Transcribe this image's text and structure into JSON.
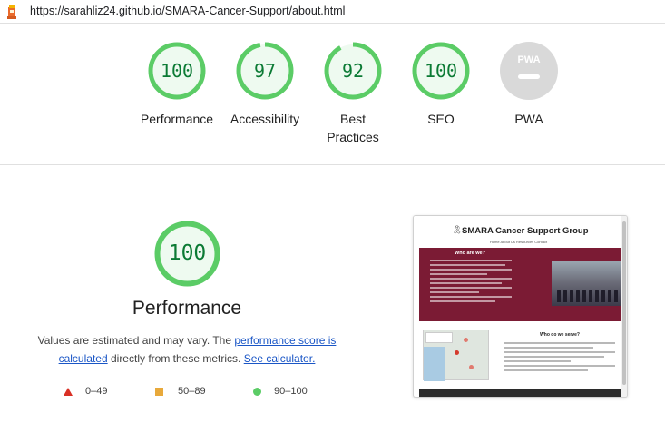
{
  "url": "https://sarahliz24.github.io/SMARA-Cancer-Support/about.html",
  "categories": [
    {
      "label": "Performance",
      "score": "100",
      "value": 100
    },
    {
      "label": "Accessibility",
      "score": "97",
      "value": 97
    },
    {
      "label_line1": "Best",
      "label_line2": "Practices",
      "score": "92",
      "value": 92
    },
    {
      "label": "SEO",
      "score": "100",
      "value": 100
    },
    {
      "label": "PWA",
      "badge": "PWA"
    }
  ],
  "section": {
    "score": "100",
    "value": 100,
    "title": "Performance",
    "note_prefix": "Values are estimated and may vary. The ",
    "link_score": "performance score is calculated",
    "note_middle": " directly from these metrics. ",
    "link_calc": "See calculator."
  },
  "legend": [
    {
      "label": "0–49",
      "color": "#d93025"
    },
    {
      "label": "50–89",
      "color": "#e8a93b"
    },
    {
      "label": "90–100",
      "color": "#5bcc66"
    }
  ],
  "thumbnail": {
    "site_title": "SMARA Cancer Support Group",
    "nav": "Home  About Us  Resources  Contact",
    "who_heading": "Who are we?",
    "serve_heading": "Who do we serve?"
  },
  "colors": {
    "pass": "#0b7a34",
    "pass_ring": "#5bcc66",
    "pass_fill": "#eefaf0",
    "pwa_gray": "#d9d9d9",
    "maroon": "#7b1b34"
  }
}
